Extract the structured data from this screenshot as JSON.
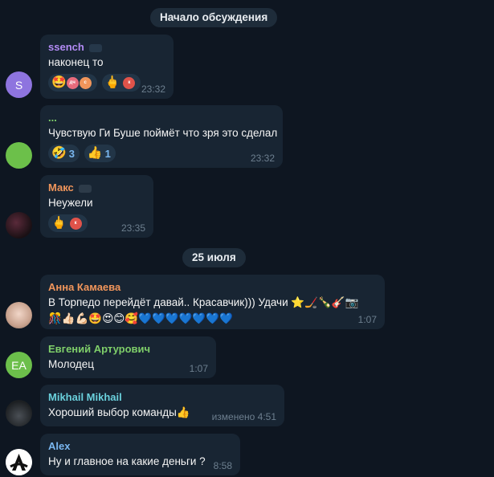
{
  "separators": {
    "discussion_start": "Начало обсуждения",
    "date": "25 июля"
  },
  "messages": [
    {
      "author": "ssench",
      "avatar_letter": "S",
      "text": "наконец то",
      "time": "23:32",
      "reactions": [
        {
          "emoji": "🤩",
          "mini_avatars": [
            "дч",
            "с"
          ]
        },
        {
          "emoji": "🖕",
          "mini_avatars": [
            "к"
          ]
        }
      ]
    },
    {
      "author": "...",
      "text": "Чувствую Ги Буше поймёт что зря это сделал",
      "time": "23:32",
      "reactions": [
        {
          "emoji": "🤣",
          "count": "3"
        },
        {
          "emoji": "👍",
          "count": "1"
        }
      ]
    },
    {
      "author": "Макс",
      "text": "Неужели",
      "time": "23:35",
      "reactions": [
        {
          "emoji": "🖕",
          "mini_avatars": [
            "к"
          ]
        }
      ]
    },
    {
      "author": "Анна Камаева",
      "text_line1": "В Торпедо перейдёт давай.. Красавчик))) Удачи ⭐🏒🍾🎸📷",
      "text_line2": "🎊👍🏻💪🏻🤩😍😊🥰💙💙💙💙💙💙💙",
      "time": "1:07"
    },
    {
      "author": "Евгений Артурович",
      "avatar_letter": "EA",
      "text": "Молодец",
      "time": "1:07"
    },
    {
      "author": "Mikhail Mikhail",
      "text": "Хороший выбор команды👍",
      "time": "изменено 4:51"
    },
    {
      "author": "Alex",
      "text": "Ну и главное на какие деньги ?",
      "time": "8:58"
    }
  ],
  "colors": {
    "background": "#0e1621",
    "bubble": "#182533",
    "name_purple": "#b28bf4",
    "name_green": "#7fcf6a",
    "name_orange": "#f0955b",
    "name_cyan": "#6ad0dc",
    "name_blue": "#7ab7f0"
  }
}
